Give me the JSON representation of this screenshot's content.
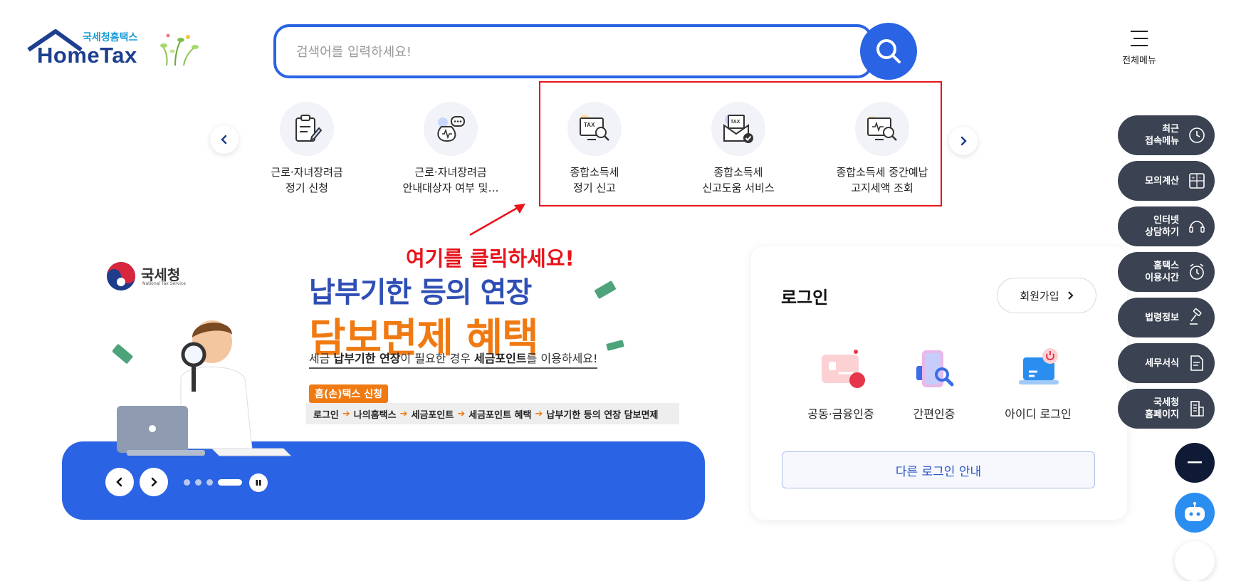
{
  "header": {
    "logo_sub": "국세청홈택스",
    "logo_main": "HomeTax",
    "search_placeholder": "검색어를 입력하세요!",
    "search_value": "",
    "all_menu_label": "전체메뉴"
  },
  "quick_menu": {
    "items": [
      {
        "label": "근로·자녀장려금\n정기 신청",
        "icon": "document-pen-icon"
      },
      {
        "label": "근로·자녀장려금\n안내대상자 여부 및…",
        "icon": "money-bag-chat-icon"
      },
      {
        "label": "종합소득세\n정기 신고",
        "icon": "tax-monitor-search-icon"
      },
      {
        "label": "종합소득세\n신고도움 서비스",
        "icon": "tax-envelope-check-icon"
      },
      {
        "label": "종합소득세 중간예납\n고지세액 조회",
        "icon": "monitor-search-icon"
      }
    ],
    "annotation": "여기를 클릭하세요!",
    "highlight_color": "#e8131b"
  },
  "banner": {
    "agency_name": "국세청",
    "agency_name_en": "National Tax Service",
    "title_line1": "납부기한 등의 연장",
    "title_line2": "담보면제 혜택",
    "description_pre": "세금 ",
    "description_bold1": "납부기한 연장",
    "description_mid": "이 필요한 경우 ",
    "description_bold2": "세금포인트",
    "description_post": "를 이용하세요!",
    "tag": "홈(손)택스 신청",
    "steps": [
      "로그인",
      "나의홈택스",
      "세금포인트",
      "세금포인트 혜택",
      "납부기한 등의 연장 담보면제"
    ],
    "slide_count": 4,
    "active_slide": 4
  },
  "login": {
    "title": "로그인",
    "signup_label": "회원가입",
    "options": [
      {
        "label": "공동·금융인증",
        "icon": "certificate-card-icon"
      },
      {
        "label": "간편인증",
        "icon": "phone-search-icon"
      },
      {
        "label": "아이디 로그인",
        "icon": "laptop-power-icon"
      }
    ],
    "other_login_label": "다른 로그인 안내"
  },
  "dock": [
    {
      "label": "최근\n접속메뉴",
      "icon": "clock-icon"
    },
    {
      "label": "모의계산",
      "icon": "calculator-icon"
    },
    {
      "label": "인터넷\n상담하기",
      "icon": "headset-icon"
    },
    {
      "label": "홈택스\n이용시간",
      "icon": "alarm-clock-icon"
    },
    {
      "label": "법령정보",
      "icon": "gavel-icon"
    },
    {
      "label": "세무서식",
      "icon": "document-icon"
    },
    {
      "label": "국세청\n홈페이지",
      "icon": "building-icon"
    }
  ],
  "colors": {
    "primary": "#2a63e3",
    "navy": "#1d3f8f",
    "orange": "#f07a12",
    "dock": "#3b4352"
  }
}
